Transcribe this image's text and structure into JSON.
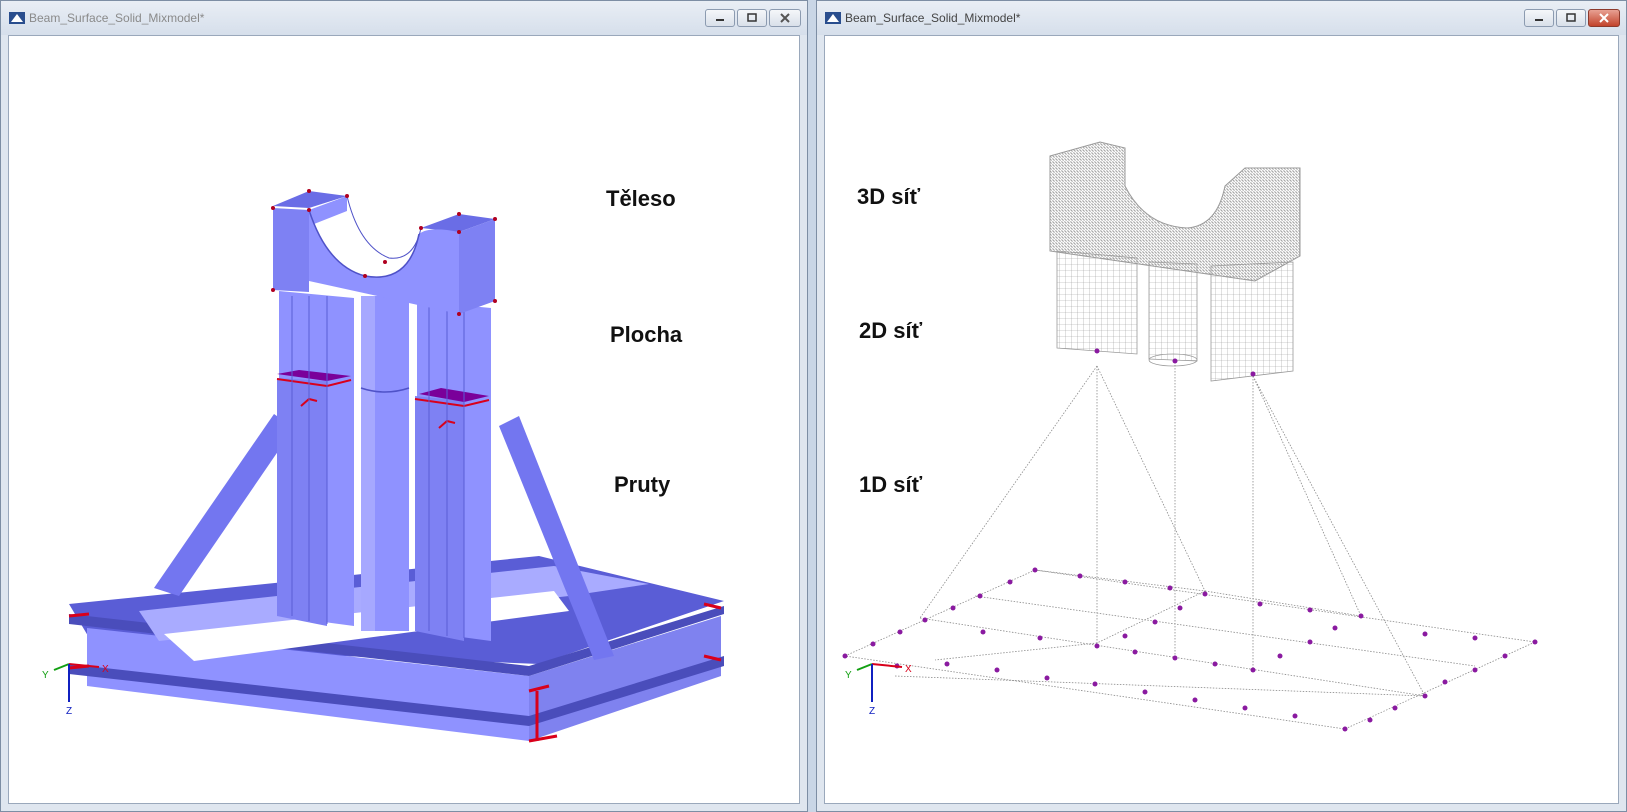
{
  "left_window": {
    "title": "Beam_Surface_Solid_Mixmodel*",
    "labels": {
      "solid": "Těleso",
      "surface": "Plocha",
      "members": "Pruty"
    },
    "axes": {
      "x": "X",
      "y": "Y",
      "z": "Z"
    }
  },
  "right_window": {
    "title": "Beam_Surface_Solid_Mixmodel*",
    "labels": {
      "mesh_3d": "3D síť",
      "mesh_2d": "2D síť",
      "mesh_1d": "1D síť"
    },
    "axes": {
      "x": "X",
      "y": "Y",
      "z": "Z"
    }
  },
  "colors": {
    "model_fill": "#8f92ff",
    "model_dark": "#4f52c8",
    "section_red": "#d9001b",
    "purple_plate": "#7a009a",
    "mesh_gray": "#9a9a9a",
    "node_purple": "#8a1aa0"
  }
}
